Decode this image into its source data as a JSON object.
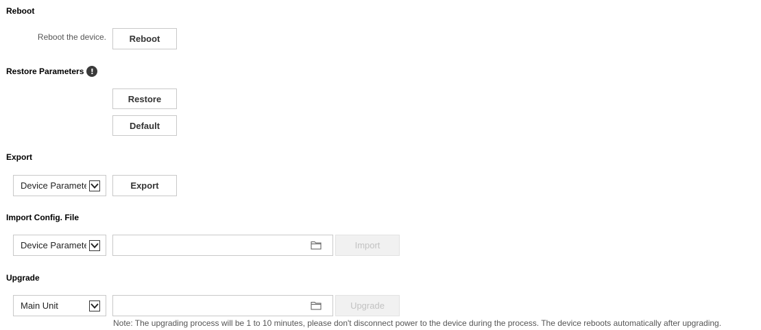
{
  "reboot": {
    "title": "Reboot",
    "description": "Reboot the device.",
    "button_label": "Reboot"
  },
  "restore": {
    "title": "Restore Parameters",
    "info_icon": "exclamation-icon",
    "restore_label": "Restore",
    "default_label": "Default"
  },
  "export": {
    "title": "Export",
    "select_value": "Device Parameters",
    "button_label": "Export"
  },
  "import_config": {
    "title": "Import Config. File",
    "select_value": "Device Parameters",
    "file_path": "",
    "folder_icon": "folder-icon",
    "button_label": "Import"
  },
  "upgrade": {
    "title": "Upgrade",
    "select_value": "Main Unit",
    "file_path": "",
    "folder_icon": "folder-icon",
    "button_label": "Upgrade",
    "note": "Note: The upgrading process will be 1 to 10 minutes, please don't disconnect power to the device during the process. The device reboots automatically after upgrading."
  }
}
